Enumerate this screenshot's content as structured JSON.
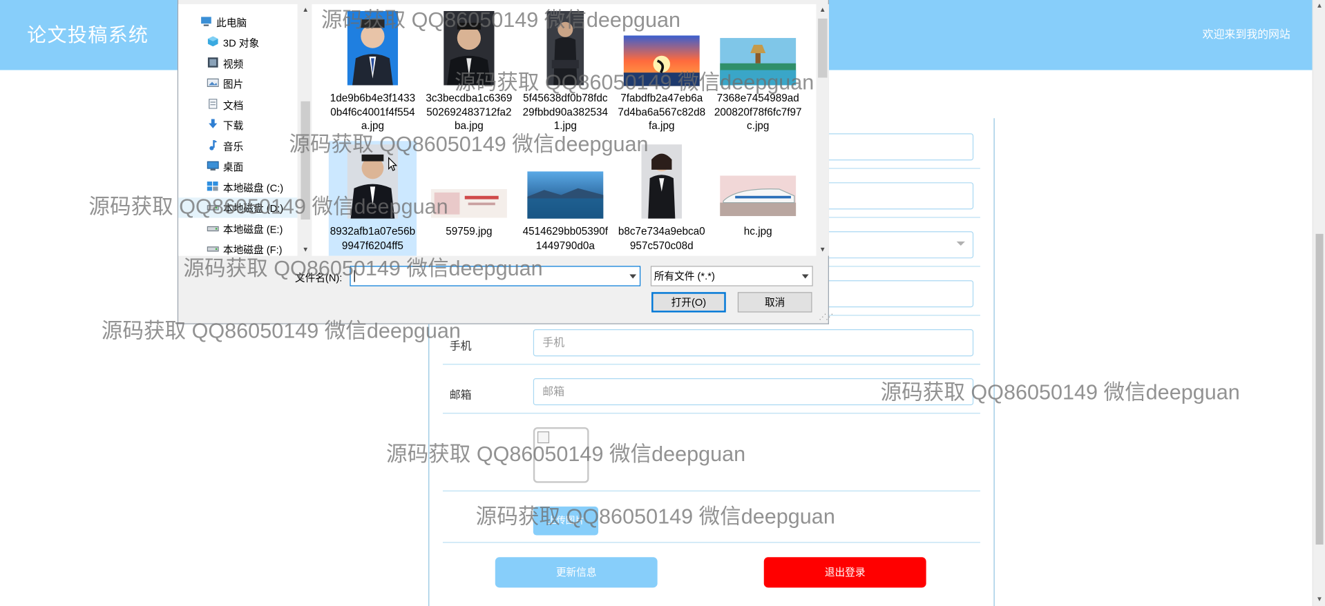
{
  "header": {
    "title": "论文投稿系统",
    "welcome": "欢迎来到我的网站"
  },
  "form": {
    "phone": {
      "label": "手机",
      "placeholder": "手机"
    },
    "email": {
      "label": "邮箱",
      "placeholder": "邮箱"
    },
    "upload_label": "上传图片",
    "update_label": "更新信息",
    "logout_label": "退出登录"
  },
  "dialog": {
    "nav_items": [
      {
        "label": "此电脑",
        "icon": "computer-icon"
      },
      {
        "label": "3D 对象",
        "icon": "3d-objects-icon"
      },
      {
        "label": "视频",
        "icon": "videos-icon"
      },
      {
        "label": "图片",
        "icon": "pictures-icon"
      },
      {
        "label": "文档",
        "icon": "documents-icon"
      },
      {
        "label": "下载",
        "icon": "downloads-icon"
      },
      {
        "label": "音乐",
        "icon": "music-icon"
      },
      {
        "label": "桌面",
        "icon": "desktop-icon"
      },
      {
        "label": "本地磁盘 (C:)",
        "icon": "windows-drive-icon"
      },
      {
        "label": "本地磁盘 (D:)",
        "icon": "drive-icon"
      },
      {
        "label": "本地磁盘 (E:)",
        "icon": "drive-icon"
      },
      {
        "label": "本地磁盘 (F:)",
        "icon": "drive-icon"
      }
    ],
    "files": [
      {
        "name": "1de9b6b4e3f14330b4f6c4001f4f554a.jpg",
        "thumb": "portrait-man-blue-bg"
      },
      {
        "name": "3c3becdba1c6369502692483712fa2ba.jpg",
        "thumb": "portrait-man-dark-bg"
      },
      {
        "name": "5f45638df0b78fdc29fbbd90a3825341.jpg",
        "thumb": "man-seated-dark"
      },
      {
        "name": "7fabdfb2a47eb6a7d4ba6a567c82d8fa.jpg",
        "thumb": "sunset-landscape"
      },
      {
        "name": "7368e7454989ad200820f78f6fc7f97c.jpg",
        "thumb": "pagoda-landscape"
      },
      {
        "name": "8932afb1a07e56b9947f6204ff5",
        "thumb": "portrait-man-suit"
      },
      {
        "name": "59759.jpg",
        "thumb": "banner-image"
      },
      {
        "name": "4514629bb05390f1449790d0a",
        "thumb": "lake-landscape"
      },
      {
        "name": "b8c7e734a9ebca0957c570c08d",
        "thumb": "portrait-woman-suit"
      },
      {
        "name": "hc.jpg",
        "thumb": "high-speed-train"
      }
    ],
    "filename_label": "文件名(N):",
    "filename_value": "",
    "filetype_value": "所有文件 (*.*)",
    "open_label": "打开(O)",
    "cancel_label": "取消"
  },
  "watermark_text": "源码获取 QQ86050149 微信deepguan"
}
